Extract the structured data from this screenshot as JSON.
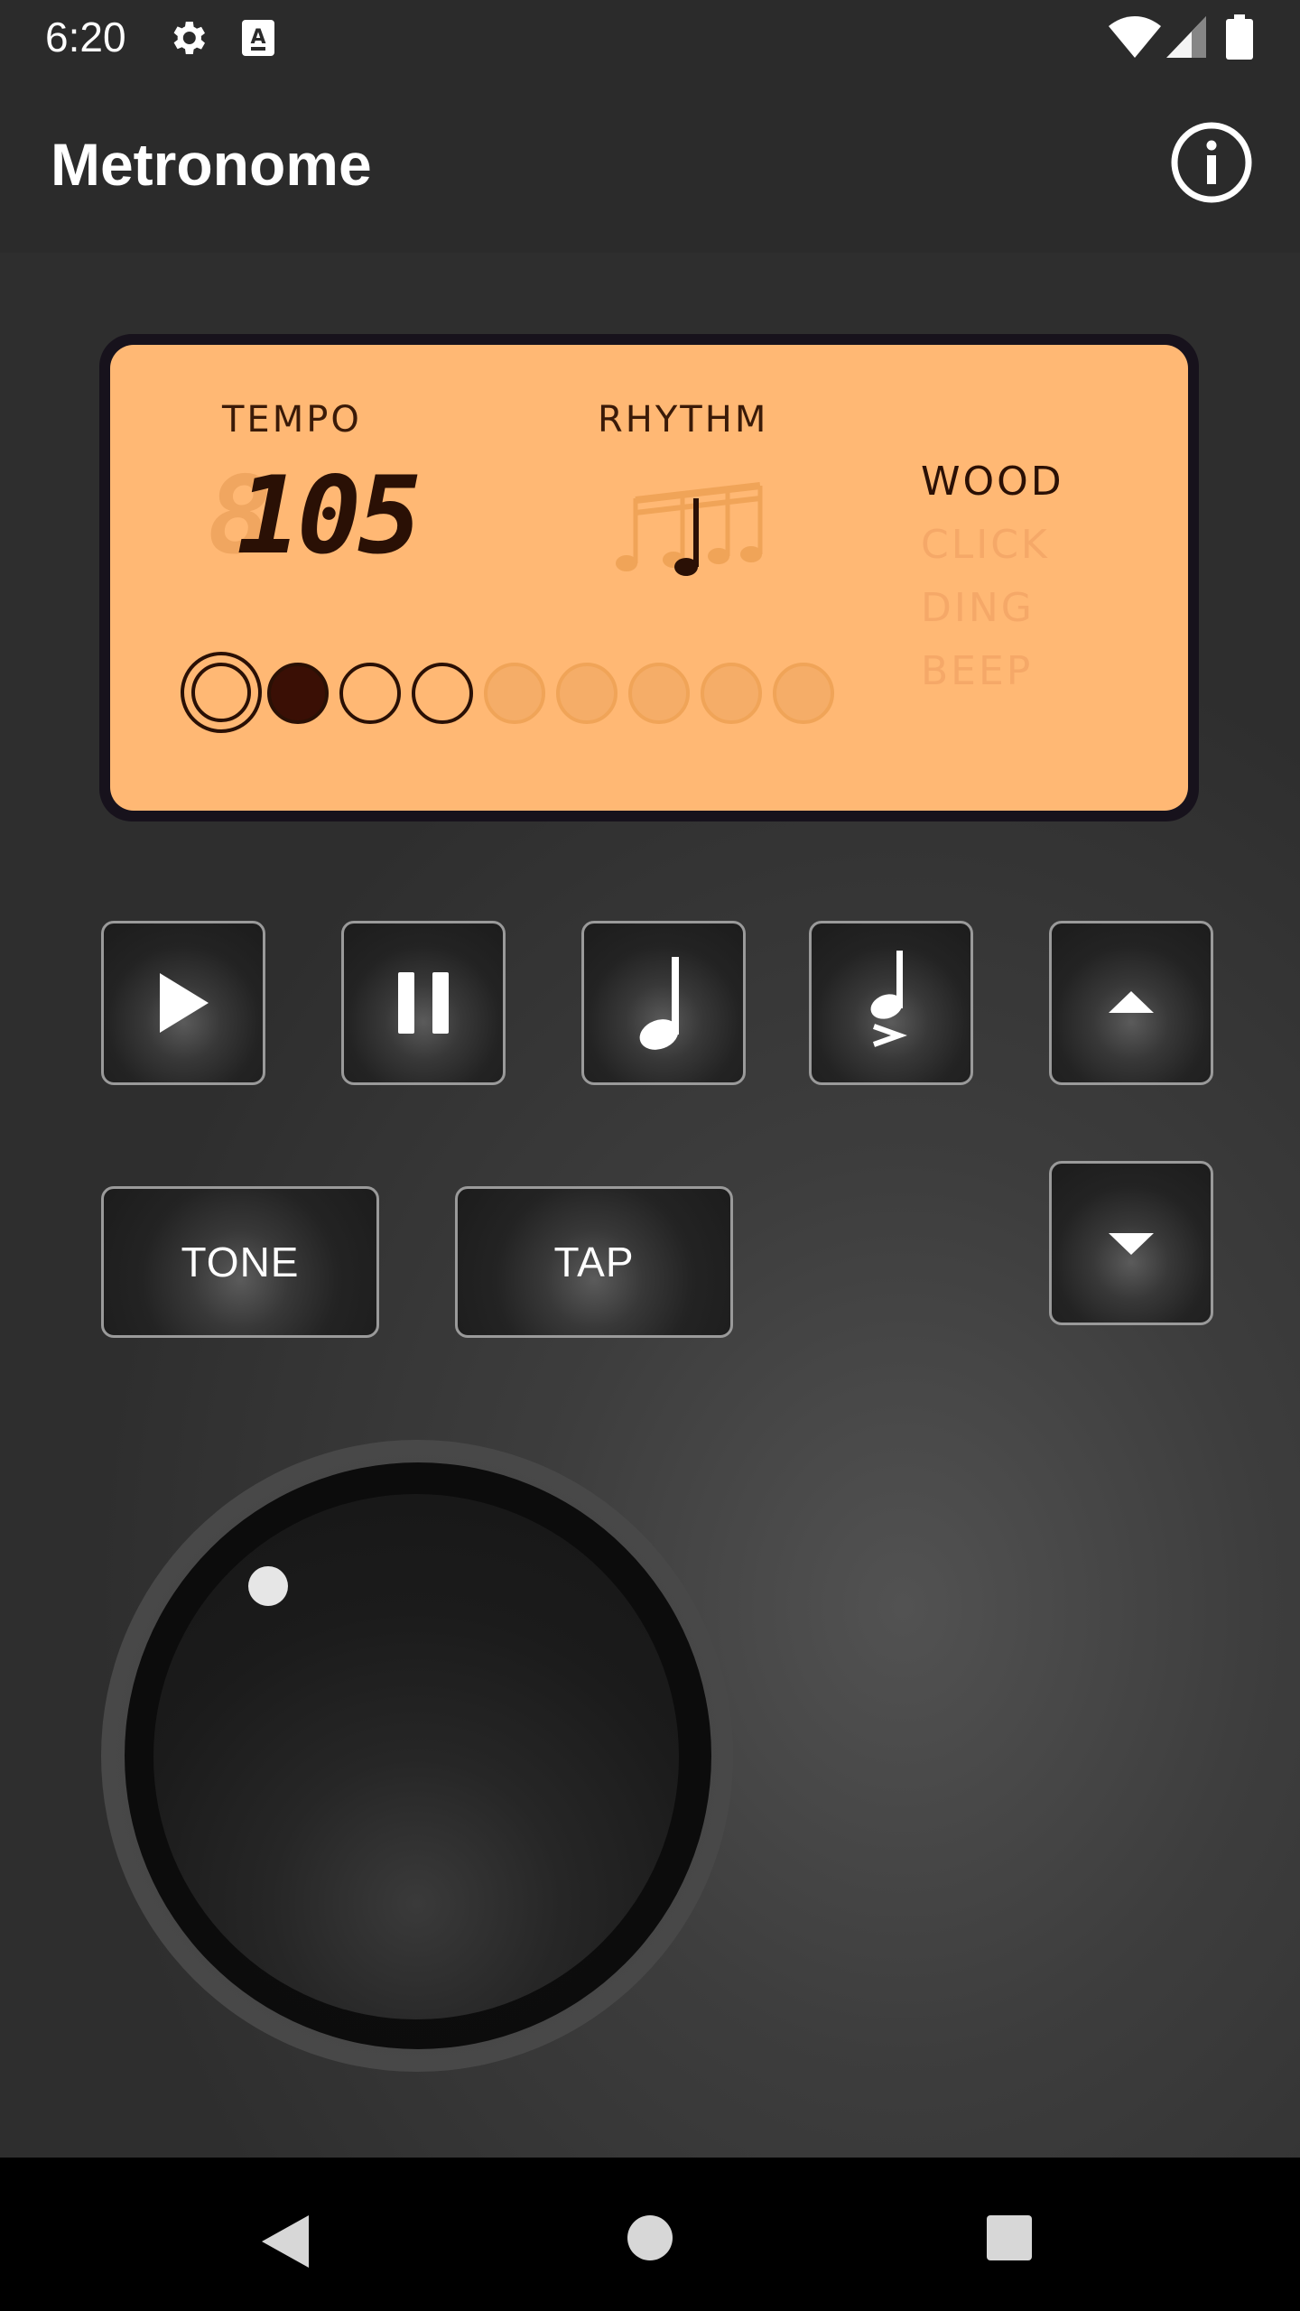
{
  "status_bar": {
    "time": "6:20",
    "icons": [
      "gear-icon",
      "keyboard-a-icon",
      "wifi-icon",
      "signal-icon",
      "battery-icon"
    ]
  },
  "app_bar": {
    "title": "Metronome",
    "info_icon": "info-icon"
  },
  "display": {
    "tempo_label": "TEMPO",
    "tempo_value": "105",
    "rhythm_label": "RHYTHM",
    "rhythm_icon": "quarter-note-icon",
    "sounds": [
      "WOOD",
      "CLICK",
      "DING",
      "BEEP"
    ],
    "selected_sound": "WOOD",
    "beats_total": 9,
    "beats_active": 4,
    "current_beat": 2,
    "colors": {
      "lcd_background": "#ffb874",
      "lcd_foreground": "#2a1005"
    }
  },
  "controls": {
    "play_icon": "play-icon",
    "pause_icon": "pause-icon",
    "note_icon": "quarter-note-icon",
    "accent_icon": "accented-note-icon",
    "up_icon": "chevron-up-icon",
    "down_icon": "chevron-down-icon",
    "tone_label": "TONE",
    "tap_label": "TAP"
  },
  "nav_bar": {
    "icons": [
      "back-icon",
      "home-icon",
      "recents-icon"
    ]
  }
}
